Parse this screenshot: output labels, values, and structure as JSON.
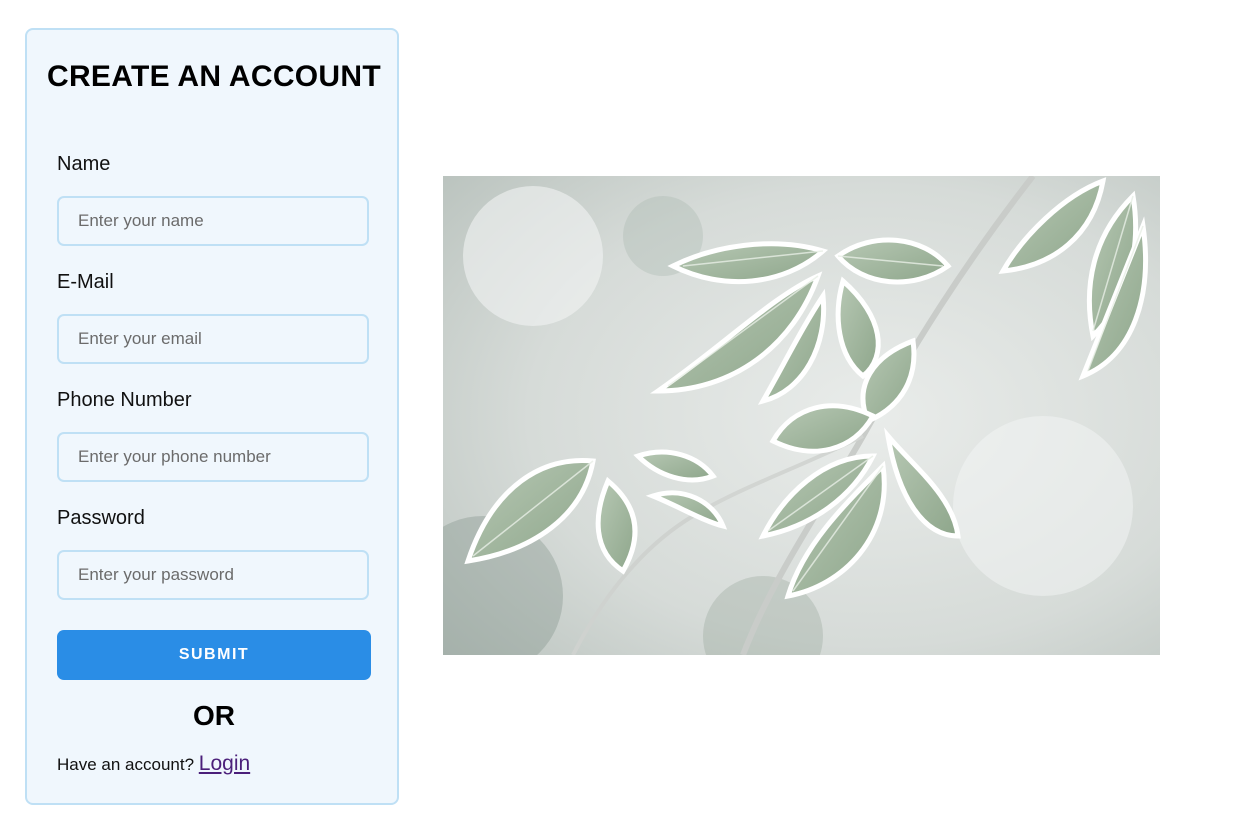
{
  "form": {
    "title": "CREATE AN ACCOUNT",
    "fields": [
      {
        "label": "Name",
        "placeholder": "Enter your name"
      },
      {
        "label": "E-Mail",
        "placeholder": "Enter your email"
      },
      {
        "label": "Phone Number",
        "placeholder": "Enter your phone number"
      },
      {
        "label": "Password",
        "placeholder": "Enter your password"
      }
    ],
    "submit_label": "SUBMIT",
    "or_text": "OR",
    "login_prompt": "Have an account?",
    "login_link": "Login"
  },
  "hero": {
    "subject": "frosted-leaves-photo"
  },
  "colors": {
    "card_background": "#f0f7fd",
    "card_border": "#bfe0f5",
    "submit_button": "#2a8de6",
    "link": "#4b1f7a"
  }
}
